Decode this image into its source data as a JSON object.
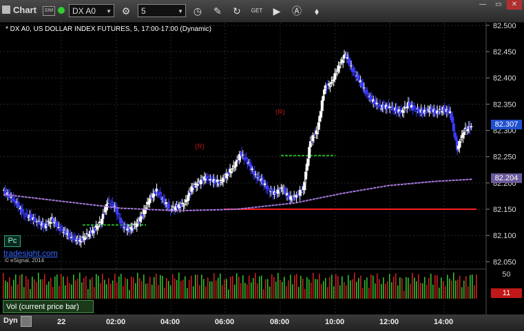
{
  "toolbar": {
    "title": "Chart",
    "sim_badge": "SIM",
    "symbol": "DX A0",
    "interval": "5",
    "tools": [
      "link-icon",
      "clock-icon",
      "pencil-icon",
      "refresh-icon",
      "get-icon",
      "play-icon",
      "alert-icon",
      "settings-icon"
    ],
    "window_buttons": {
      "minimize": "—",
      "maximize": "▭",
      "close": "✕"
    }
  },
  "chart": {
    "header": "* DX A0, US DOLLAR INDEX FUTURES, 5, 17:00-17:00 (Dynamic)",
    "brand": "tradesight.com",
    "copyright": "© eSignal, 2014",
    "pc_label": "Pc",
    "annotations": {
      "r1": "(R)",
      "r2": "(R)"
    },
    "last_price": "82.307",
    "ma_price": "82.204",
    "colors": {
      "up": "#ffffff",
      "down": "#3a3aff",
      "ma": "#a87be0",
      "red_line": "#ff2020",
      "green_line": "#23b023",
      "count_text": "#2fbf2f"
    }
  },
  "chart_data": {
    "type": "candlestick",
    "y_axis": {
      "ticks": [
        "82.500",
        "82.450",
        "82.400",
        "82.350",
        "82.300",
        "82.250",
        "82.200",
        "82.150",
        "82.100",
        "82.050"
      ],
      "range": [
        82.04,
        82.505
      ]
    },
    "x_axis": {
      "ticks": [
        "22",
        "02:00",
        "04:00",
        "06:00",
        "08:00",
        "10:00",
        "12:00",
        "14:00"
      ]
    },
    "path": [
      [
        0,
        82.185
      ],
      [
        6,
        82.175
      ],
      [
        12,
        82.16
      ],
      [
        18,
        82.14
      ],
      [
        24,
        82.135
      ],
      [
        30,
        82.125
      ],
      [
        36,
        82.118
      ],
      [
        42,
        82.13
      ],
      [
        48,
        82.115
      ],
      [
        54,
        82.105
      ],
      [
        60,
        82.095
      ],
      [
        66,
        82.09
      ],
      [
        72,
        82.1
      ],
      [
        78,
        82.11
      ],
      [
        84,
        82.125
      ],
      [
        90,
        82.165
      ],
      [
        96,
        82.155
      ],
      [
        102,
        82.12
      ],
      [
        108,
        82.11
      ],
      [
        114,
        82.12
      ],
      [
        120,
        82.14
      ],
      [
        126,
        82.17
      ],
      [
        132,
        82.185
      ],
      [
        138,
        82.165
      ],
      [
        144,
        82.15
      ],
      [
        150,
        82.155
      ],
      [
        156,
        82.16
      ],
      [
        162,
        82.19
      ],
      [
        168,
        82.2
      ],
      [
        174,
        82.21
      ],
      [
        180,
        82.205
      ],
      [
        186,
        82.2
      ],
      [
        192,
        82.215
      ],
      [
        198,
        82.23
      ],
      [
        204,
        82.255
      ],
      [
        210,
        82.24
      ],
      [
        216,
        82.215
      ],
      [
        222,
        82.205
      ],
      [
        228,
        82.185
      ],
      [
        234,
        82.18
      ],
      [
        240,
        82.19
      ],
      [
        246,
        82.17
      ],
      [
        252,
        82.175
      ],
      [
        258,
        82.19
      ],
      [
        264,
        82.28
      ],
      [
        270,
        82.3
      ],
      [
        276,
        82.38
      ],
      [
        282,
        82.39
      ],
      [
        288,
        82.42
      ],
      [
        294,
        82.445
      ],
      [
        300,
        82.415
      ],
      [
        306,
        82.395
      ],
      [
        312,
        82.37
      ],
      [
        318,
        82.355
      ],
      [
        324,
        82.345
      ],
      [
        330,
        82.345
      ],
      [
        336,
        82.34
      ],
      [
        342,
        82.335
      ],
      [
        348,
        82.35
      ],
      [
        354,
        82.34
      ],
      [
        360,
        82.335
      ],
      [
        366,
        82.34
      ],
      [
        372,
        82.335
      ],
      [
        378,
        82.34
      ],
      [
        384,
        82.335
      ],
      [
        390,
        82.265
      ],
      [
        396,
        82.3
      ],
      [
        402,
        82.307
      ]
    ],
    "ma_series": {
      "name": "",
      "values": [
        [
          0,
          82.178
        ],
        [
          50,
          82.165
        ],
        [
          100,
          82.152
        ],
        [
          150,
          82.147
        ],
        [
          200,
          82.15
        ],
        [
          250,
          82.162
        ],
        [
          290,
          82.18
        ],
        [
          330,
          82.195
        ],
        [
          370,
          82.203
        ],
        [
          402,
          82.207
        ]
      ]
    },
    "volume_axis": {
      "ticks": [
        "50",
        "11"
      ]
    },
    "volume_label": "Vol (current price bar)",
    "horizontal_lines": {
      "red": 82.15,
      "green_1": 82.12,
      "green_2": 82.252
    }
  }
}
